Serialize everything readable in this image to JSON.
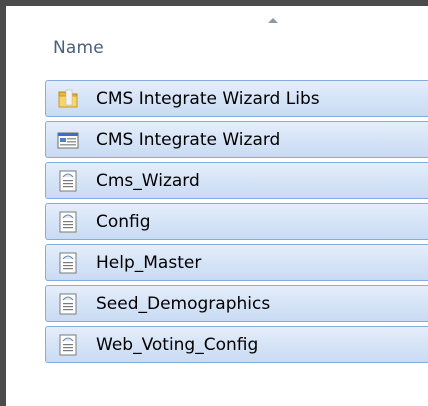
{
  "header": {
    "column_name": "Name"
  },
  "files": [
    {
      "label": "CMS Integrate Wizard Libs",
      "icon": "folder-icon"
    },
    {
      "label": "CMS Integrate Wizard",
      "icon": "application-icon"
    },
    {
      "label": "Cms_Wizard",
      "icon": "config-file-icon"
    },
    {
      "label": "Config",
      "icon": "config-file-icon"
    },
    {
      "label": "Help_Master",
      "icon": "config-file-icon"
    },
    {
      "label": "Seed_Demographics",
      "icon": "config-file-icon"
    },
    {
      "label": "Web_Voting_Config",
      "icon": "config-file-icon"
    }
  ],
  "colors": {
    "selection_fill": "#d6e4f7",
    "selection_border": "#84acdd",
    "header_text": "#4c607a"
  }
}
